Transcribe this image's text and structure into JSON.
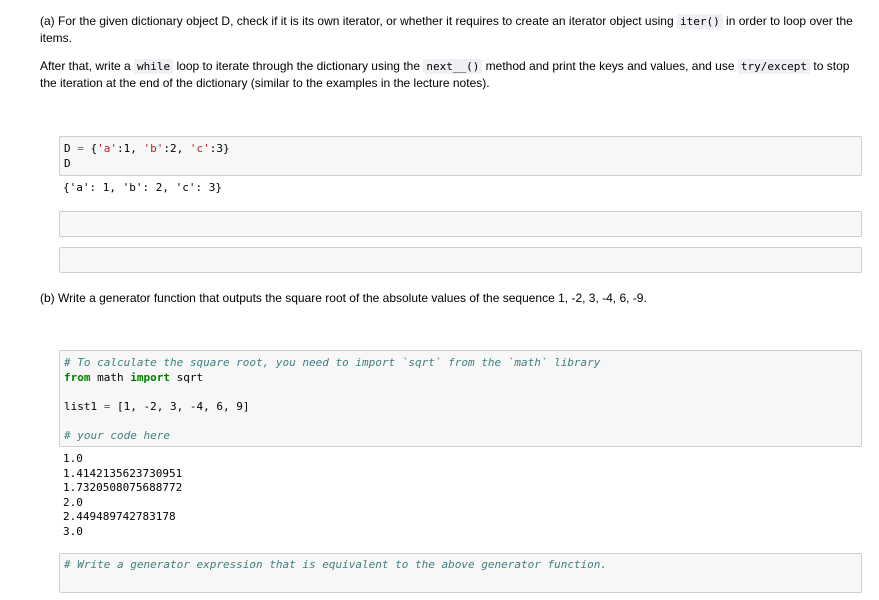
{
  "part_a": {
    "p1_pre": "(a) For the given dictionary object D, check if it is its own iterator, or whether it requires to create an iterator object using ",
    "p1_code": "iter()",
    "p1_post": " in order to loop over the items.",
    "p2_a": "After that, write a ",
    "p2_code_while": "while",
    "p2_b": " loop to iterate through the dictionary using the ",
    "p2_next": "next__()",
    "p2_c": " method and print the keys and values, and use ",
    "p2_code_try": "try/except",
    "p2_d": " to stop the iteration at the end of the dictionary (similar to the examples in the lecture notes)."
  },
  "cell1": {
    "line1_var": "D",
    "line1_eq": " = ",
    "line1_open": "{",
    "k1": "'a'",
    "v1": ":1, ",
    "k2": "'b'",
    "v2": ":2, ",
    "k3": "'c'",
    "v3": ":3}",
    "line2": "D",
    "output": "{'a': 1, 'b': 2, 'c': 3}"
  },
  "part_b": {
    "text": "(b) Write a generator function that outputs the square root of the absolute values of the sequence 1, -2, 3, -4, 6, -9."
  },
  "cell4": {
    "comment1": "# To calculate the square root, you need to import `sqrt` from the `math` library",
    "from_kw": "from",
    "module": " math ",
    "import_kw": "import",
    "import_name": " sqrt",
    "list_var": "list1",
    "list_eq": " = ",
    "list_val": "[1, -2, 3, -4, 6, 9]",
    "comment2": "# your code here",
    "outputs": [
      "1.0",
      "1.4142135623730951",
      "1.7320508075688772",
      "2.0",
      "2.449489742783178",
      "3.0"
    ]
  },
  "cell5": {
    "comment": "# Write a generator expression that is equivalent to the above generator function."
  }
}
